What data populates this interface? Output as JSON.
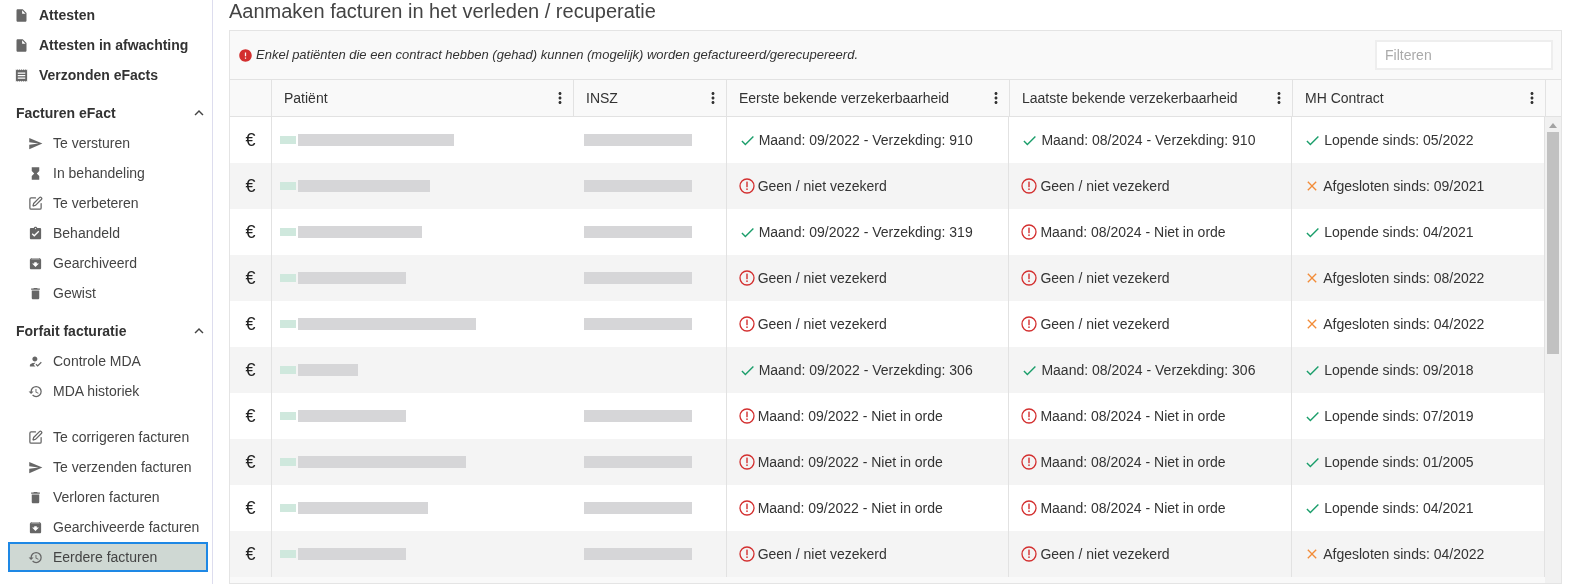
{
  "sidebar": {
    "top_items": [
      {
        "label": "Attesten",
        "selected": false
      },
      {
        "label": "Attesten in afwachting",
        "selected": false
      },
      {
        "label": "Verzonden eFacts",
        "selected": false
      }
    ],
    "sections": [
      {
        "title": "Facturen eFact",
        "expanded": true,
        "items": [
          {
            "label": "Te versturen",
            "selected": false
          },
          {
            "label": "In behandeling",
            "selected": false
          },
          {
            "label": "Te verbeteren",
            "selected": false
          },
          {
            "label": "Behandeld",
            "selected": false
          },
          {
            "label": "Gearchiveerd",
            "selected": false
          },
          {
            "label": "Gewist",
            "selected": false
          }
        ]
      },
      {
        "title": "Forfait facturatie",
        "expanded": true,
        "items": [
          {
            "label": "Controle MDA",
            "selected": false
          },
          {
            "label": "MDA historiek",
            "selected": false
          }
        ]
      }
    ],
    "extra_items": [
      {
        "label": "Te corrigeren facturen",
        "selected": false
      },
      {
        "label": "Te verzenden facturen",
        "selected": false
      },
      {
        "label": "Verloren facturen",
        "selected": false
      },
      {
        "label": "Gearchiveerde facturen",
        "selected": false
      },
      {
        "label": "Eerdere facturen",
        "selected": true
      }
    ]
  },
  "page_title": "Aanmaken facturen in het verleden / recuperatie",
  "notice": "Enkel patiënten die een contract hebben (gehad) kunnen (mogelijk) worden gefactureerd/gerecupereerd.",
  "filter": {
    "placeholder": "Filteren"
  },
  "table": {
    "columns": [
      "",
      "Patiënt",
      "INSZ",
      "Eerste bekende verzekerbaarheid",
      "Laatste bekende verzekerbaarheid",
      "MH Contract"
    ],
    "rows": [
      {
        "cells": [
          {
            "kind": "symbol",
            "text": "€"
          },
          {
            "kind": "blurred"
          },
          {
            "kind": "blurred"
          },
          {
            "kind": "ok",
            "text": "Maand: 09/2022 - Verzekding: 910"
          },
          {
            "kind": "ok",
            "text": "Maand: 08/2024 - Verzekding: 910"
          },
          {
            "kind": "ok",
            "text": "Lopende sinds: 05/2022"
          }
        ]
      },
      {
        "cells": [
          {
            "kind": "symbol",
            "text": "€"
          },
          {
            "kind": "blurred"
          },
          {
            "kind": "blurred"
          },
          {
            "kind": "error",
            "text": "Geen / niet vezekerd"
          },
          {
            "kind": "error",
            "text": "Geen / niet vezekerd"
          },
          {
            "kind": "closed",
            "text": "Afgesloten sinds: 09/2021"
          }
        ]
      },
      {
        "cells": [
          {
            "kind": "symbol",
            "text": "€"
          },
          {
            "kind": "blurred"
          },
          {
            "kind": "blurred"
          },
          {
            "kind": "ok",
            "text": "Maand: 09/2022 - Verzekding: 319"
          },
          {
            "kind": "error",
            "text": "Maand: 08/2024 - Niet in orde"
          },
          {
            "kind": "ok",
            "text": "Lopende sinds: 04/2021"
          }
        ]
      },
      {
        "cells": [
          {
            "kind": "symbol",
            "text": "€"
          },
          {
            "kind": "blurred"
          },
          {
            "kind": "blurred"
          },
          {
            "kind": "error",
            "text": "Geen / niet vezekerd"
          },
          {
            "kind": "error",
            "text": "Geen / niet vezekerd"
          },
          {
            "kind": "closed",
            "text": "Afgesloten sinds: 08/2022"
          }
        ]
      },
      {
        "cells": [
          {
            "kind": "symbol",
            "text": "€"
          },
          {
            "kind": "blurred"
          },
          {
            "kind": "blurred"
          },
          {
            "kind": "error",
            "text": "Geen / niet vezekerd"
          },
          {
            "kind": "error",
            "text": "Geen / niet vezekerd"
          },
          {
            "kind": "closed",
            "text": "Afgesloten sinds: 04/2022"
          }
        ]
      },
      {
        "cells": [
          {
            "kind": "symbol",
            "text": "€"
          },
          {
            "kind": "blurred"
          },
          {
            "kind": "empty"
          },
          {
            "kind": "ok",
            "text": "Maand: 09/2022 - Verzekding: 306"
          },
          {
            "kind": "ok",
            "text": "Maand: 08/2024 - Verzekding: 306"
          },
          {
            "kind": "ok",
            "text": "Lopende sinds: 09/2018"
          }
        ]
      },
      {
        "cells": [
          {
            "kind": "symbol",
            "text": "€"
          },
          {
            "kind": "blurred"
          },
          {
            "kind": "blurred"
          },
          {
            "kind": "error",
            "text": "Maand: 09/2022 - Niet in orde"
          },
          {
            "kind": "error",
            "text": "Maand: 08/2024 - Niet in orde"
          },
          {
            "kind": "ok",
            "text": "Lopende sinds: 07/2019"
          }
        ]
      },
      {
        "cells": [
          {
            "kind": "symbol",
            "text": "€"
          },
          {
            "kind": "blurred"
          },
          {
            "kind": "blurred"
          },
          {
            "kind": "error",
            "text": "Maand: 09/2022 - Niet in orde"
          },
          {
            "kind": "error",
            "text": "Maand: 08/2024 - Niet in orde"
          },
          {
            "kind": "ok",
            "text": "Lopende sinds: 01/2005"
          }
        ]
      },
      {
        "cells": [
          {
            "kind": "symbol",
            "text": "€"
          },
          {
            "kind": "blurred"
          },
          {
            "kind": "blurred"
          },
          {
            "kind": "error",
            "text": "Maand: 09/2022 - Niet in orde"
          },
          {
            "kind": "error",
            "text": "Maand: 08/2024 - Niet in orde"
          },
          {
            "kind": "ok",
            "text": "Lopende sinds: 04/2021"
          }
        ]
      },
      {
        "cells": [
          {
            "kind": "symbol",
            "text": "€"
          },
          {
            "kind": "blurred"
          },
          {
            "kind": "blurred"
          },
          {
            "kind": "error",
            "text": "Geen / niet vezekerd"
          },
          {
            "kind": "error",
            "text": "Geen / niet vezekerd"
          },
          {
            "kind": "closed",
            "text": "Afgesloten sinds: 04/2022"
          }
        ]
      }
    ]
  }
}
